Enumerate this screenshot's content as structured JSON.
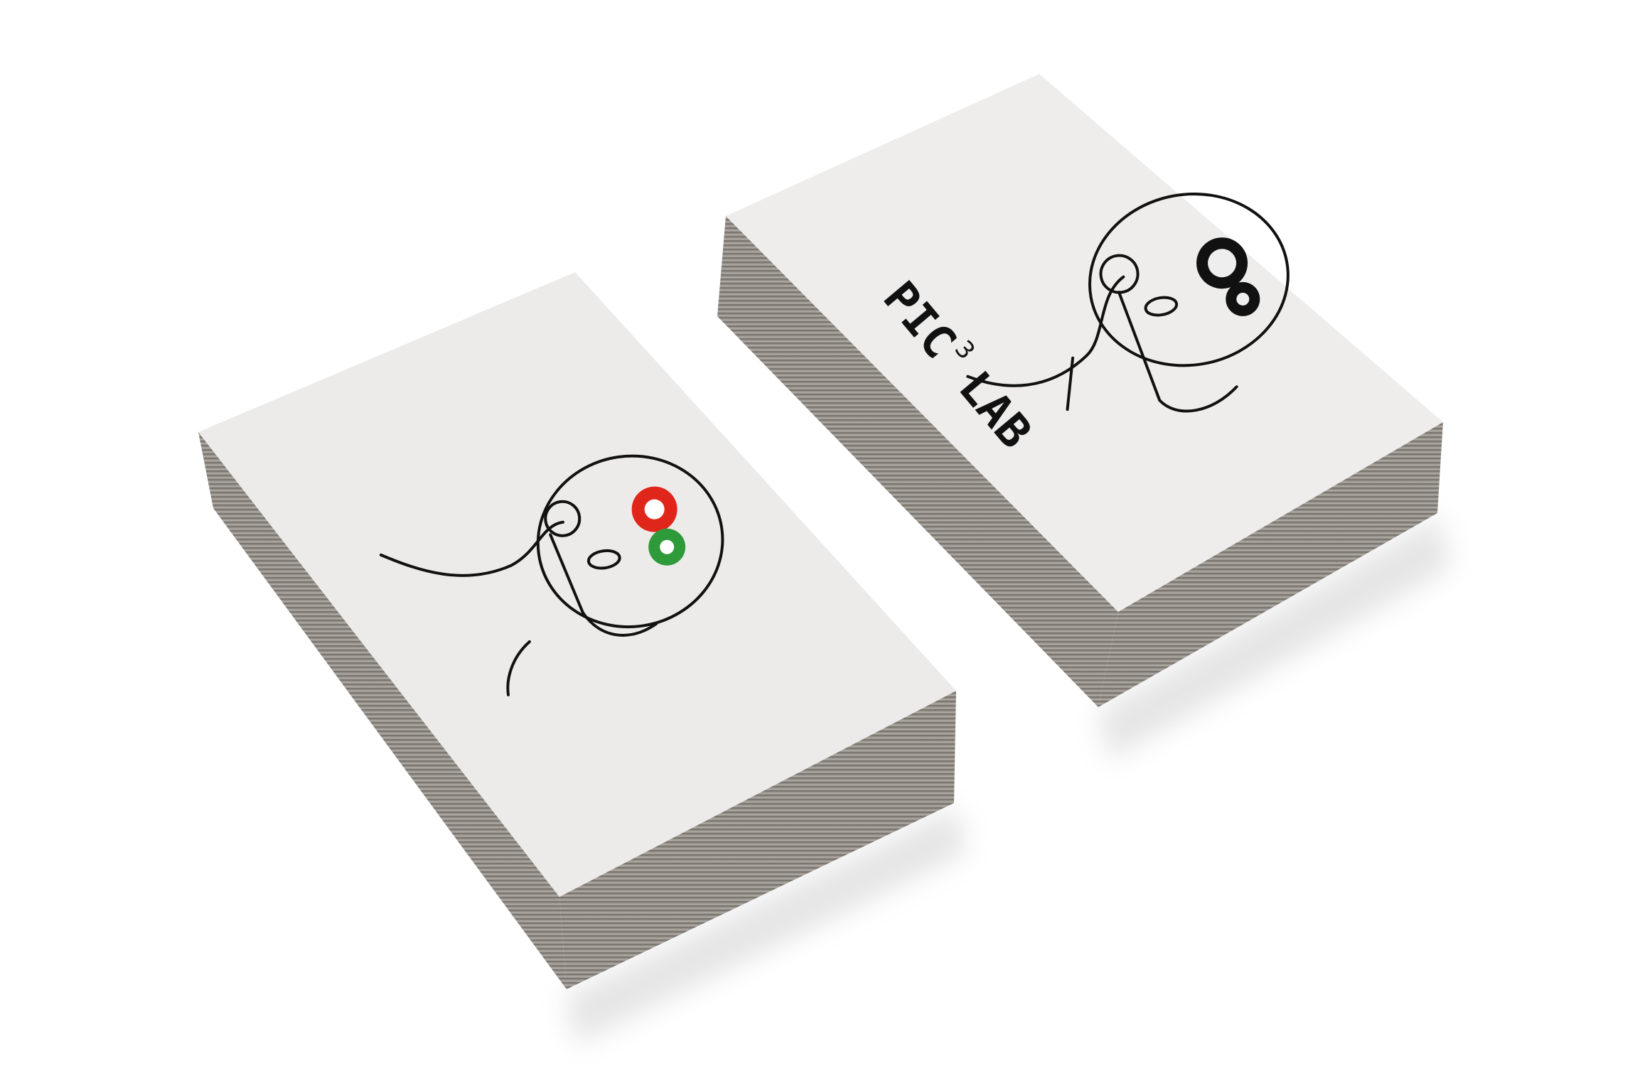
{
  "scene": {
    "description_tag": "",
    "colors": {
      "background": "#ffffff",
      "card_face": "#ececeb",
      "card_edge": "#8a8580",
      "ink": "#111111",
      "gear_red": "#e0261b",
      "gear_green": "#2f9a3a"
    }
  },
  "card_right": {
    "logo_main": "PIC",
    "logo_sup": "3",
    "logo_tail": "LAB",
    "icon": "head-with-gears-icon"
  },
  "card_left": {
    "icon": "head-with-colored-gears-icon"
  }
}
